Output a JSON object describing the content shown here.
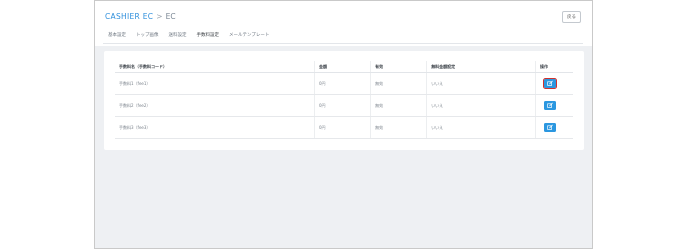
{
  "breadcrumb": {
    "home": "CASHIER EC",
    "separator": ">",
    "current": "EC"
  },
  "back_button": "戻る",
  "tabs": [
    {
      "label": "基本設定",
      "active": false
    },
    {
      "label": "トップ画像",
      "active": false
    },
    {
      "label": "送料設定",
      "active": false
    },
    {
      "label": "手数料設定",
      "active": true
    },
    {
      "label": "メールテンプレート",
      "active": false
    }
  ],
  "table": {
    "headers": [
      "手数料名（手数料コード）",
      "金額",
      "有効",
      "無料金額設定",
      "操作"
    ],
    "rows": [
      {
        "name": "手数料1（fee1）",
        "amount": "0円",
        "enabled": "無効",
        "free_setting": "いいえ"
      },
      {
        "name": "手数料2（fee2）",
        "amount": "0円",
        "enabled": "無効",
        "free_setting": "いいえ"
      },
      {
        "name": "手数料3（fee3）",
        "amount": "0円",
        "enabled": "無効",
        "free_setting": "いいえ"
      }
    ]
  },
  "colors": {
    "accent": "#2b97e0",
    "highlight": "#d0322e",
    "background": "#eef0f3"
  },
  "icons": {
    "edit": "edit-icon"
  }
}
